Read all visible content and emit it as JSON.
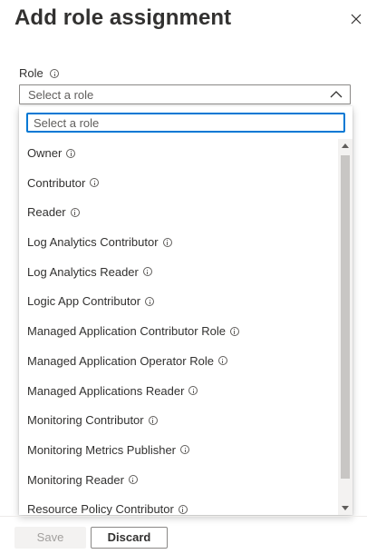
{
  "panel": {
    "title": "Add role assignment"
  },
  "role_field": {
    "label": "Role",
    "placeholder": "Select a role"
  },
  "dropdown": {
    "search_placeholder": "Select a role",
    "items": [
      {
        "label": "Owner"
      },
      {
        "label": "Contributor"
      },
      {
        "label": "Reader"
      },
      {
        "label": "Log Analytics Contributor"
      },
      {
        "label": "Log Analytics Reader"
      },
      {
        "label": "Logic App Contributor"
      },
      {
        "label": "Managed Application Contributor Role"
      },
      {
        "label": "Managed Application Operator Role"
      },
      {
        "label": "Managed Applications Reader"
      },
      {
        "label": "Monitoring Contributor"
      },
      {
        "label": "Monitoring Metrics Publisher"
      },
      {
        "label": "Monitoring Reader"
      },
      {
        "label": "Resource Policy Contributor"
      }
    ]
  },
  "footer": {
    "save_label": "Save",
    "discard_label": "Discard"
  }
}
